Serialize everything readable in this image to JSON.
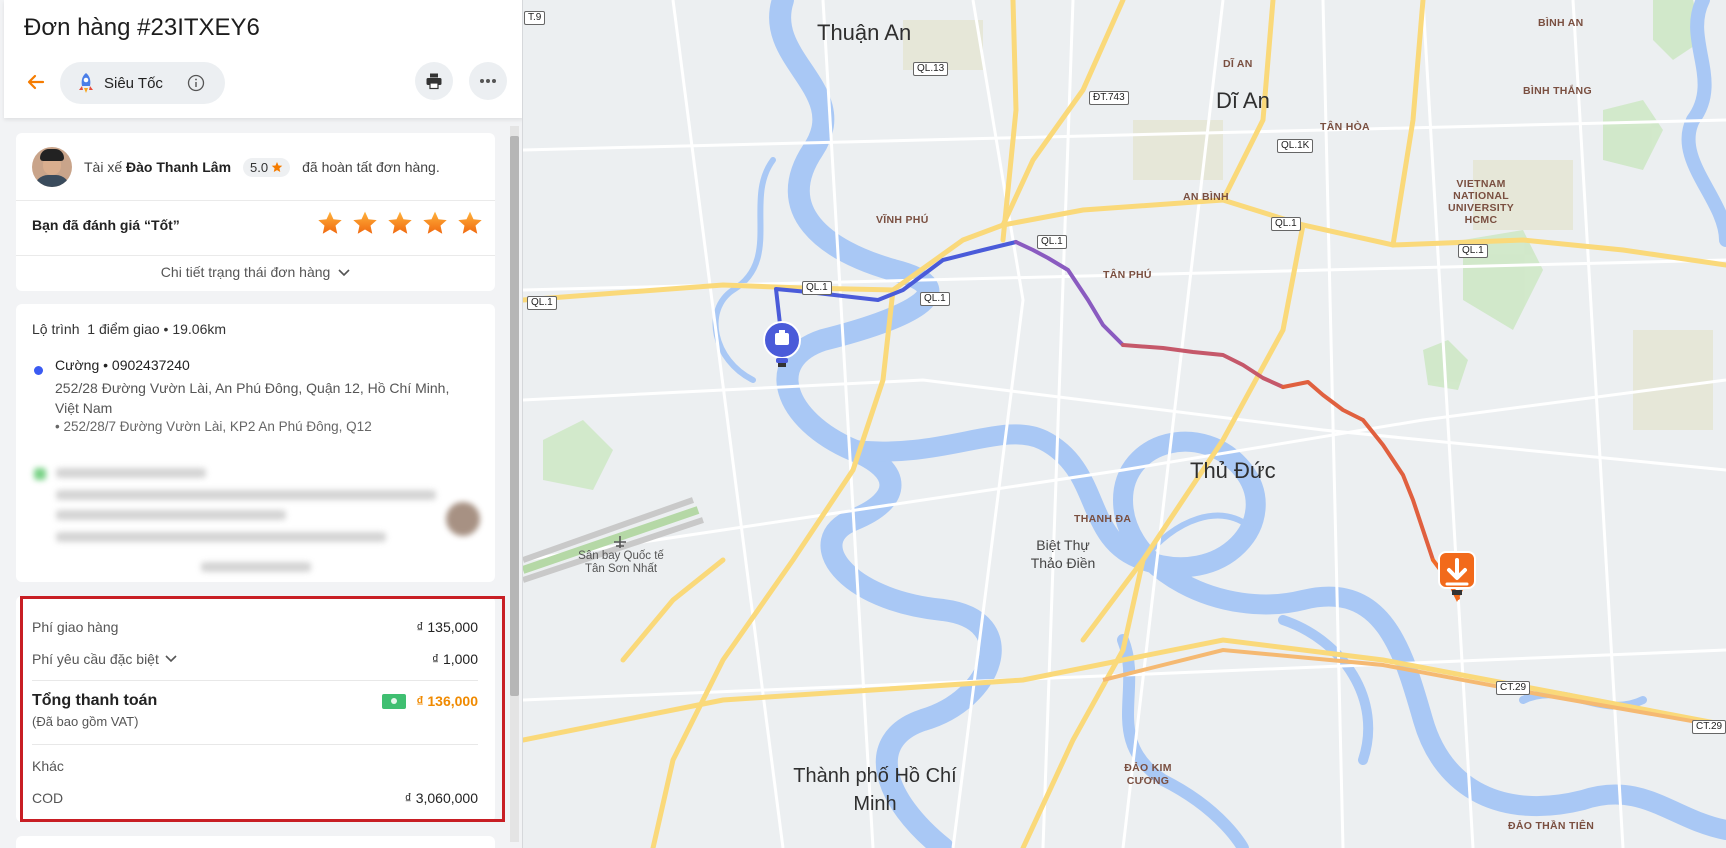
{
  "order": {
    "title": "Đơn hàng #23ITXEY6",
    "service": "Siêu Tốc"
  },
  "driver": {
    "prefix": "Tài xế",
    "name": "Đào Thanh Lâm",
    "rating": "5.0",
    "suffix": "đã hoàn tất đơn hàng."
  },
  "review": {
    "text": "Bạn đã đánh giá “Tốt”",
    "stars": 5
  },
  "status_link": "Chi tiết trạng thái đơn hàng",
  "route": {
    "label": "Lộ trình",
    "summary": "1 điểm giao • 19.06km",
    "pickup_name": "Cường • 0902437240",
    "pickup_address": "252/28 Đường Vườn Lài, An Phú Đông, Quận 12, Hồ Chí Minh, Việt Nam",
    "pickup_note": "• 252/28/7 Đường Vườn Lài, KP2 An Phú Đông, Q12"
  },
  "fees": {
    "delivery_label": "Phí giao hàng",
    "delivery_value": "₫ 135,000",
    "special_label": "Phí yêu cầu đặc biệt",
    "special_value": "₫ 1,000",
    "total_label": "Tổng thanh toán",
    "total_sub": "(Đã bao gồm VAT)",
    "total_value": "₫ 136,000",
    "other_label": "Khác",
    "cod_label": "COD",
    "cod_value": "₫ 3,060,000"
  },
  "map": {
    "labels": {
      "thuan_an": "Thuận An",
      "di_an": "Dĩ An",
      "di_an_small": "DĨ AN",
      "binh_an": "BÌNH AN",
      "binh_thang": "BÌNH THẮNG",
      "tan_hoa": "TÂN HÒA",
      "an_binh": "AN BÌNH",
      "vinh_phu": "VĨNH PHÚ",
      "tan_phu": "TÂN PHÚ",
      "vnu": "VIETNAM NATIONAL UNIVERSITY HCMC",
      "thu_duc": "Thủ Đức",
      "thanh_da": "THANH ĐA",
      "biet_thu": "Biệt Thự Thảo Điền",
      "airport": "Sân bay Quốc tế Tân Sơn Nhất",
      "hcm": "Thành phố Hồ Chí Minh",
      "dao_kim_cuong": "ĐẢO KIM CƯƠNG",
      "dao_than_tien": "ĐẢO THẦN TIÊN"
    },
    "shields": {
      "ql13": "QL.13",
      "dt743": "ĐT.743",
      "ql1k": "QL.1K",
      "ql1": "QL.1",
      "ct29": "CT.29",
      "t9": "T.9"
    },
    "route_colors": [
      "#4a5bd9",
      "#8a5bc0",
      "#c5586a",
      "#e85a30"
    ]
  }
}
